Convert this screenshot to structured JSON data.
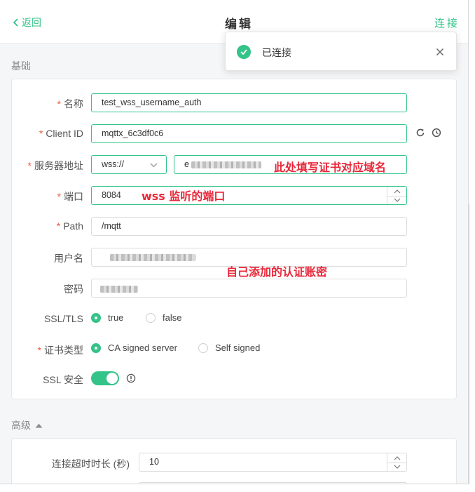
{
  "header": {
    "back_label": "返回",
    "title": "编辑",
    "connect_label": "连接"
  },
  "toast": {
    "message": "已连接"
  },
  "sections": {
    "basic": "基础",
    "advanced": "高级"
  },
  "form": {
    "name_label": "名称",
    "name_value": "test_wss_username_auth",
    "client_id_label": "Client ID",
    "client_id_value": "mqttx_6c3df0c6",
    "host_label": "服务器地址",
    "protocol_value": "wss://",
    "host_value": "e",
    "port_label": "端口",
    "port_value": "8084",
    "path_label": "Path",
    "path_value": "/mqtt",
    "username_label": "用户名",
    "password_label": "密码",
    "ssl_label": "SSL/TLS",
    "ssl_true": "true",
    "ssl_false": "false",
    "ssl_selected": "true",
    "cert_label": "证书类型",
    "cert_ca": "CA signed server",
    "cert_self": "Self signed",
    "cert_selected": "CA signed server",
    "ssl_secure_label": "SSL 安全",
    "ssl_secure_on": true
  },
  "advanced": {
    "timeout_label": "连接超时时长 (秒)",
    "timeout_value": "10"
  },
  "annotations": {
    "host_note": "此处填写证书对应域名",
    "port_note": "wss 监听的端口",
    "auth_note": "自己添加的认证账密"
  },
  "colors": {
    "accent": "#34c388",
    "annotation": "#e8283a",
    "required": "#e8593c"
  }
}
